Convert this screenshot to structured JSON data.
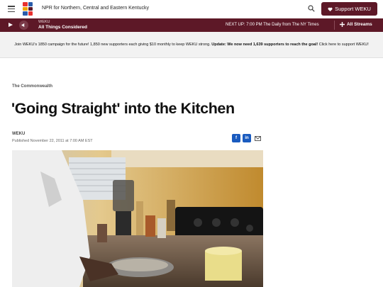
{
  "header": {
    "tagline": "NPR for Northern, Central and Eastern Kentucky",
    "support_label": "Support WEKU",
    "logo_colors": [
      "#e8312f",
      "#2a5caa",
      "#f0a500",
      "#5d1827"
    ]
  },
  "player": {
    "station": "WEKU",
    "program": "All Things Considered",
    "next_up": "NEXT UP: 7:00 PM The Daily from The NY Times",
    "all_streams_label": "All Streams"
  },
  "banner": {
    "text_plain": "Join WEKU's 1850 campaign for the future! 1,850 new supporters each giving $10 monthly to keep WEKU strong. ",
    "text_bold": "Update: We now need 1,639 supporters to reach the goal!",
    "text_link": " Click here to support WEKU!"
  },
  "article": {
    "section": "The Commonwealth",
    "headline": "'Going Straight' into the Kitchen",
    "author": "WEKU",
    "published": "Published November 22, 2011 at 7:00 AM EST"
  },
  "colors": {
    "brand": "#5d1827",
    "share_blue": "#1a5bbf"
  },
  "icons": {
    "menu": "hamburger-icon",
    "search": "search-icon",
    "heart": "heart-icon",
    "play": "play-icon",
    "volume": "volume-icon",
    "streams": "plus-icon",
    "facebook": "facebook-icon",
    "linkedin": "linkedin-icon",
    "email": "mail-icon"
  }
}
